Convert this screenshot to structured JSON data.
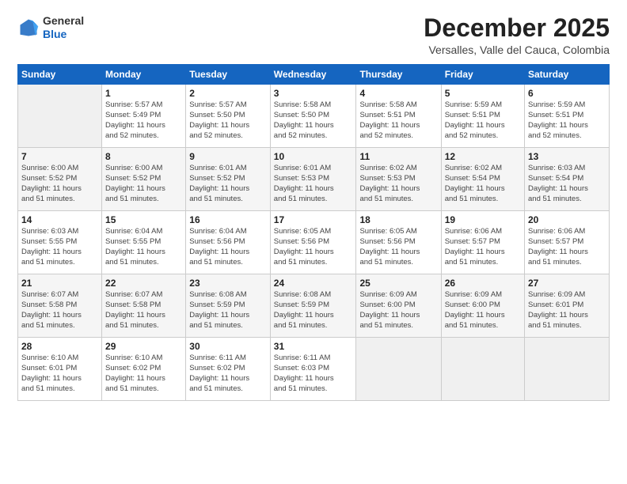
{
  "logo": {
    "general": "General",
    "blue": "Blue"
  },
  "header": {
    "title": "December 2025",
    "subtitle": "Versalles, Valle del Cauca, Colombia"
  },
  "days_of_week": [
    "Sunday",
    "Monday",
    "Tuesday",
    "Wednesday",
    "Thursday",
    "Friday",
    "Saturday"
  ],
  "weeks": [
    [
      {
        "day": "",
        "info": ""
      },
      {
        "day": "1",
        "info": "Sunrise: 5:57 AM\nSunset: 5:49 PM\nDaylight: 11 hours\nand 52 minutes."
      },
      {
        "day": "2",
        "info": "Sunrise: 5:57 AM\nSunset: 5:50 PM\nDaylight: 11 hours\nand 52 minutes."
      },
      {
        "day": "3",
        "info": "Sunrise: 5:58 AM\nSunset: 5:50 PM\nDaylight: 11 hours\nand 52 minutes."
      },
      {
        "day": "4",
        "info": "Sunrise: 5:58 AM\nSunset: 5:51 PM\nDaylight: 11 hours\nand 52 minutes."
      },
      {
        "day": "5",
        "info": "Sunrise: 5:59 AM\nSunset: 5:51 PM\nDaylight: 11 hours\nand 52 minutes."
      },
      {
        "day": "6",
        "info": "Sunrise: 5:59 AM\nSunset: 5:51 PM\nDaylight: 11 hours\nand 52 minutes."
      }
    ],
    [
      {
        "day": "7",
        "info": "Sunrise: 6:00 AM\nSunset: 5:52 PM\nDaylight: 11 hours\nand 51 minutes."
      },
      {
        "day": "8",
        "info": "Sunrise: 6:00 AM\nSunset: 5:52 PM\nDaylight: 11 hours\nand 51 minutes."
      },
      {
        "day": "9",
        "info": "Sunrise: 6:01 AM\nSunset: 5:52 PM\nDaylight: 11 hours\nand 51 minutes."
      },
      {
        "day": "10",
        "info": "Sunrise: 6:01 AM\nSunset: 5:53 PM\nDaylight: 11 hours\nand 51 minutes."
      },
      {
        "day": "11",
        "info": "Sunrise: 6:02 AM\nSunset: 5:53 PM\nDaylight: 11 hours\nand 51 minutes."
      },
      {
        "day": "12",
        "info": "Sunrise: 6:02 AM\nSunset: 5:54 PM\nDaylight: 11 hours\nand 51 minutes."
      },
      {
        "day": "13",
        "info": "Sunrise: 6:03 AM\nSunset: 5:54 PM\nDaylight: 11 hours\nand 51 minutes."
      }
    ],
    [
      {
        "day": "14",
        "info": "Sunrise: 6:03 AM\nSunset: 5:55 PM\nDaylight: 11 hours\nand 51 minutes."
      },
      {
        "day": "15",
        "info": "Sunrise: 6:04 AM\nSunset: 5:55 PM\nDaylight: 11 hours\nand 51 minutes."
      },
      {
        "day": "16",
        "info": "Sunrise: 6:04 AM\nSunset: 5:56 PM\nDaylight: 11 hours\nand 51 minutes."
      },
      {
        "day": "17",
        "info": "Sunrise: 6:05 AM\nSunset: 5:56 PM\nDaylight: 11 hours\nand 51 minutes."
      },
      {
        "day": "18",
        "info": "Sunrise: 6:05 AM\nSunset: 5:56 PM\nDaylight: 11 hours\nand 51 minutes."
      },
      {
        "day": "19",
        "info": "Sunrise: 6:06 AM\nSunset: 5:57 PM\nDaylight: 11 hours\nand 51 minutes."
      },
      {
        "day": "20",
        "info": "Sunrise: 6:06 AM\nSunset: 5:57 PM\nDaylight: 11 hours\nand 51 minutes."
      }
    ],
    [
      {
        "day": "21",
        "info": "Sunrise: 6:07 AM\nSunset: 5:58 PM\nDaylight: 11 hours\nand 51 minutes."
      },
      {
        "day": "22",
        "info": "Sunrise: 6:07 AM\nSunset: 5:58 PM\nDaylight: 11 hours\nand 51 minutes."
      },
      {
        "day": "23",
        "info": "Sunrise: 6:08 AM\nSunset: 5:59 PM\nDaylight: 11 hours\nand 51 minutes."
      },
      {
        "day": "24",
        "info": "Sunrise: 6:08 AM\nSunset: 5:59 PM\nDaylight: 11 hours\nand 51 minutes."
      },
      {
        "day": "25",
        "info": "Sunrise: 6:09 AM\nSunset: 6:00 PM\nDaylight: 11 hours\nand 51 minutes."
      },
      {
        "day": "26",
        "info": "Sunrise: 6:09 AM\nSunset: 6:00 PM\nDaylight: 11 hours\nand 51 minutes."
      },
      {
        "day": "27",
        "info": "Sunrise: 6:09 AM\nSunset: 6:01 PM\nDaylight: 11 hours\nand 51 minutes."
      }
    ],
    [
      {
        "day": "28",
        "info": "Sunrise: 6:10 AM\nSunset: 6:01 PM\nDaylight: 11 hours\nand 51 minutes."
      },
      {
        "day": "29",
        "info": "Sunrise: 6:10 AM\nSunset: 6:02 PM\nDaylight: 11 hours\nand 51 minutes."
      },
      {
        "day": "30",
        "info": "Sunrise: 6:11 AM\nSunset: 6:02 PM\nDaylight: 11 hours\nand 51 minutes."
      },
      {
        "day": "31",
        "info": "Sunrise: 6:11 AM\nSunset: 6:03 PM\nDaylight: 11 hours\nand 51 minutes."
      },
      {
        "day": "",
        "info": ""
      },
      {
        "day": "",
        "info": ""
      },
      {
        "day": "",
        "info": ""
      }
    ]
  ]
}
